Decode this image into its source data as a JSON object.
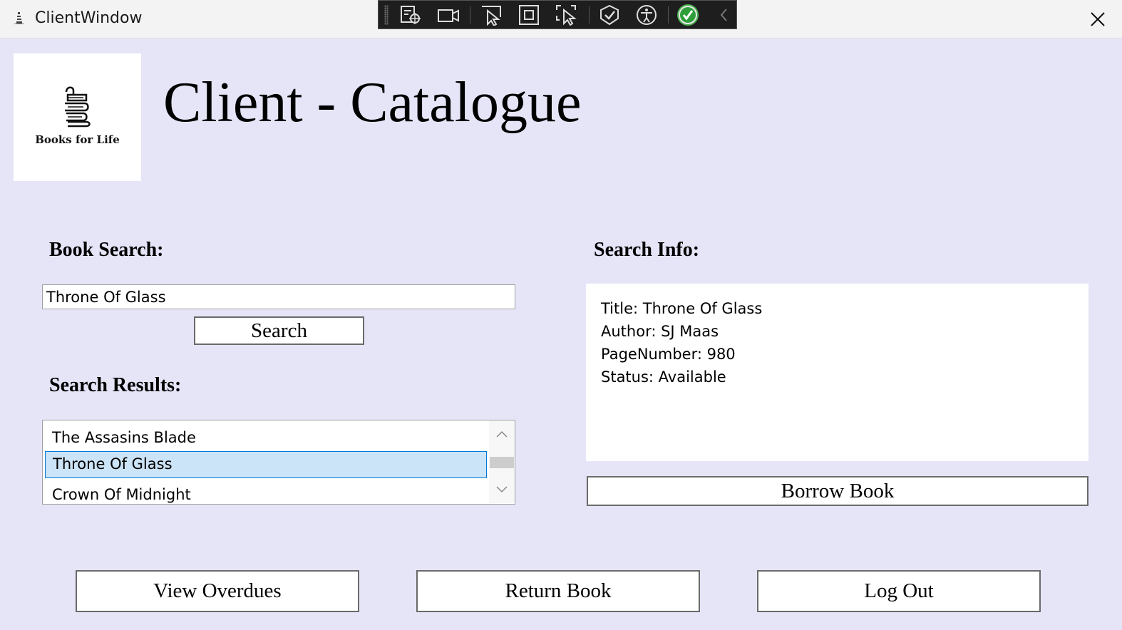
{
  "window": {
    "title": "ClientWindow",
    "close_icon": "close-icon"
  },
  "devtools": {
    "icons": [
      "live-visual-tree-icon",
      "video-icon",
      "select-element-icon",
      "display-layout-adorners-icon",
      "track-focus-icon",
      "binding-failures-icon",
      "accessibility-icon",
      "check-icon",
      "chevron-left-icon"
    ]
  },
  "header": {
    "logo_text": "Books for Life",
    "page_title": "Client - Catalogue"
  },
  "search": {
    "label": "Book Search:",
    "input_value": "Throne Of Glass",
    "button_label": "Search"
  },
  "results": {
    "label": "Search Results:",
    "items": [
      {
        "title": "The Assasins Blade",
        "selected": false
      },
      {
        "title": "Throne Of Glass",
        "selected": true
      },
      {
        "title": "Crown Of Midnight",
        "selected": false
      }
    ]
  },
  "info": {
    "label": "Search Info:",
    "lines": [
      "Title: Throne Of Glass",
      "Author: SJ Maas",
      "PageNumber: 980",
      "Status: Available"
    ],
    "borrow_label": "Borrow Book"
  },
  "footer": {
    "view_overdues_label": "View Overdues",
    "return_book_label": "Return Book",
    "log_out_label": "Log Out"
  },
  "colors": {
    "background": "#e6e5f8",
    "selection": "#cce4f7",
    "selection_border": "#0078d7"
  }
}
